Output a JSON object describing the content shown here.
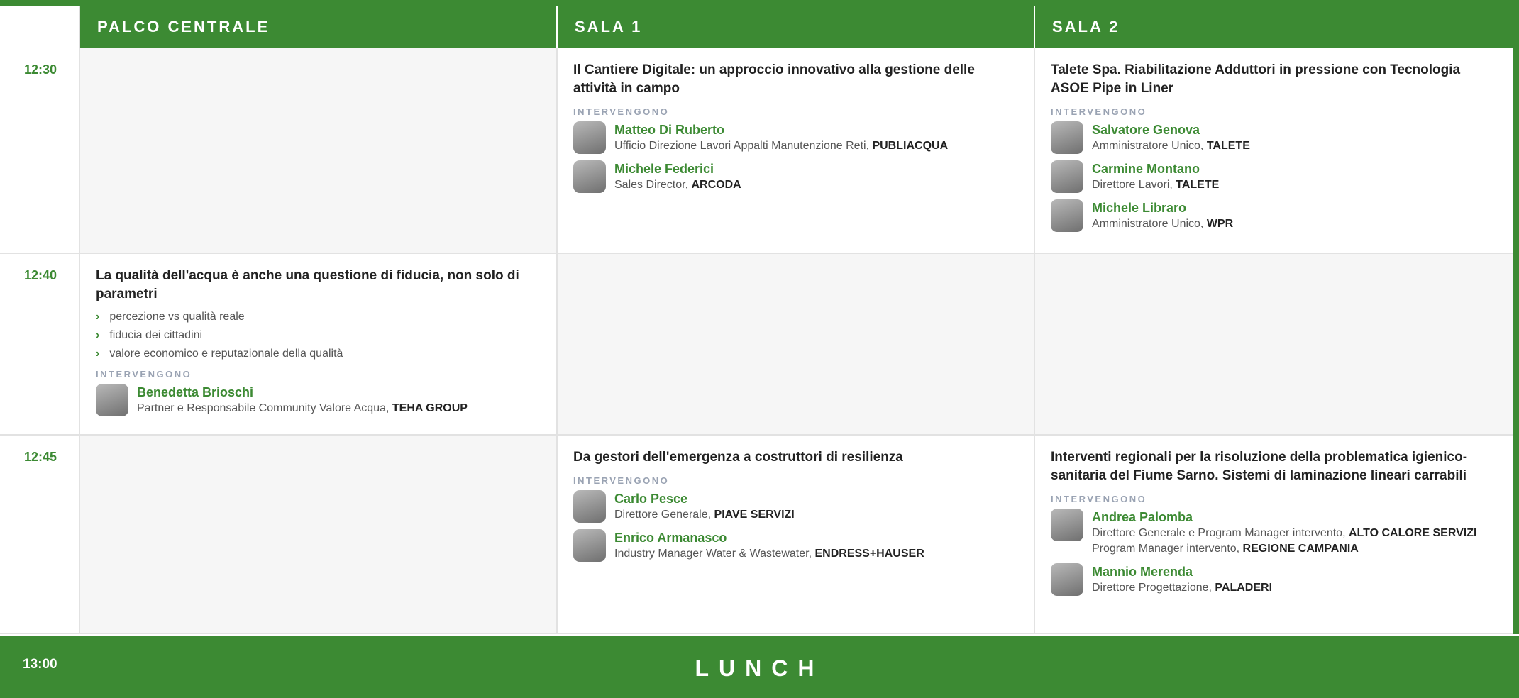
{
  "columns": [
    "PALCO CENTRALE",
    "SALA 1",
    "SALA 2"
  ],
  "section_label": "INTERVENGONO",
  "colors": {
    "accent": "#3c8a33"
  },
  "slots": [
    {
      "time": "12:30",
      "sala1": {
        "title": "Il Cantiere Digitale: un approccio innovativo alla gestione delle attività in campo",
        "speakers": [
          {
            "name": "Matteo Di Ruberto",
            "role": "Ufficio Direzione Lavori Appalti Manutenzione Reti, ",
            "org": "PUBLIACQUA"
          },
          {
            "name": "Michele Federici",
            "role": "Sales Director, ",
            "org": "ARCODA"
          }
        ]
      },
      "sala2": {
        "title": "Talete Spa. Riabilitazione Adduttori in pressione con Tecnologia ASOE Pipe in Liner",
        "speakers": [
          {
            "name": "Salvatore Genova",
            "role": "Amministratore Unico, ",
            "org": "TALETE"
          },
          {
            "name": "Carmine Montano",
            "role": "Direttore Lavori, ",
            "org": "TALETE"
          },
          {
            "name": "Michele Libraro",
            "role": "Amministratore Unico, ",
            "org": "WPR"
          }
        ]
      }
    },
    {
      "time": "12:40",
      "palco": {
        "title": "La qualità dell'acqua è anche una questione di fiducia, non solo di parametri",
        "bullets": [
          "percezione vs qualità reale",
          "fiducia dei cittadini",
          "valore economico e reputazionale della qualità"
        ],
        "speakers": [
          {
            "name": "Benedetta Brioschi",
            "role": "Partner e Responsabile Community Valore Acqua, ",
            "org": "TEHA GROUP"
          }
        ]
      }
    },
    {
      "time": "12:45",
      "sala1": {
        "title": "Da gestori dell'emergenza a costruttori di resilienza",
        "speakers": [
          {
            "name": "Carlo Pesce",
            "role": "Direttore Generale, ",
            "org": "PIAVE SERVIZI"
          },
          {
            "name": "Enrico Armanasco",
            "role": "Industry Manager Water & Wastewater, ",
            "org": "ENDRESS+HAUSER"
          }
        ]
      },
      "sala2": {
        "title": "Interventi regionali per la risoluzione della problematica igienico-sanitaria del Fiume Sarno. Sistemi di laminazione lineari carrabili",
        "speakers": [
          {
            "name": "Andrea Palomba",
            "role": "Direttore Generale e Program Manager intervento, ",
            "org": "ALTO CALORE SERVIZI",
            "role2": "Program Manager intervento, ",
            "org2": "REGIONE CAMPANIA"
          },
          {
            "name": "Mannio Merenda",
            "role": "Direttore Progettazione, ",
            "org": "PALADERI"
          }
        ]
      }
    }
  ],
  "lunch": {
    "time": "13:00",
    "label": "LUNCH"
  }
}
